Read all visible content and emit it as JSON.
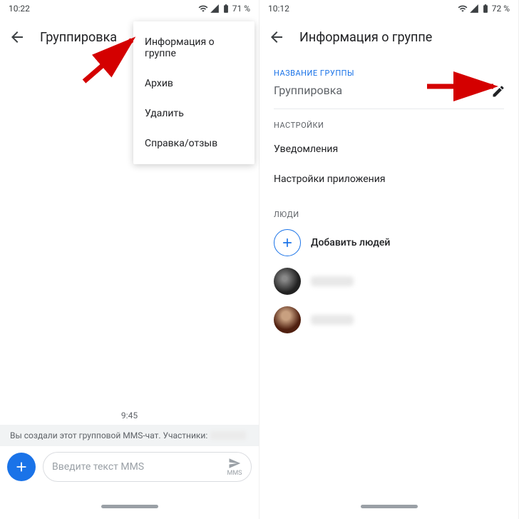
{
  "left": {
    "time": "10:22",
    "battery": "71 %",
    "title": "Группировка",
    "menu": {
      "info": "Информация о группе",
      "archive": "Архив",
      "delete": "Удалить",
      "help": "Справка/отзыв"
    },
    "msg_time": "9:45",
    "sys_msg": "Вы создали этот групповой MMS-чат. Участники:",
    "compose_placeholder": "Введите текст MMS",
    "send_label": "MMS"
  },
  "right": {
    "time": "10:12",
    "battery": "72 %",
    "title": "Информация о группе",
    "section_name": "НАЗВАНИЕ ГРУППЫ",
    "group_name": "Группировка",
    "section_settings": "НАСТРОЙКИ",
    "notifications": "Уведомления",
    "app_settings": "Настройки приложения",
    "section_people": "ЛЮДИ",
    "add_people": "Добавить людей"
  }
}
